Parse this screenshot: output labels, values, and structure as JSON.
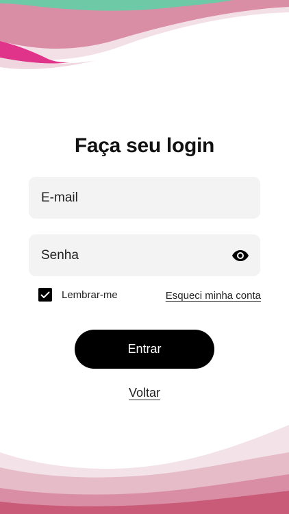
{
  "login": {
    "title": "Faça seu login",
    "email_placeholder": "E-mail",
    "password_placeholder": "Senha",
    "remember_label": "Lembrar-me",
    "remember_checked": true,
    "forgot_label": "Esqueci minha conta",
    "submit_label": "Entrar",
    "back_label": "Voltar"
  },
  "icons": {
    "password_toggle": "eye-icon",
    "checkbox_mark": "checkmark-icon"
  },
  "colors": {
    "primary": "#000000",
    "field_background": "#f3f3f3",
    "wave_green": "#6ec9a6",
    "wave_pink": "#d98ea6",
    "wave_magenta": "#e0338a"
  }
}
